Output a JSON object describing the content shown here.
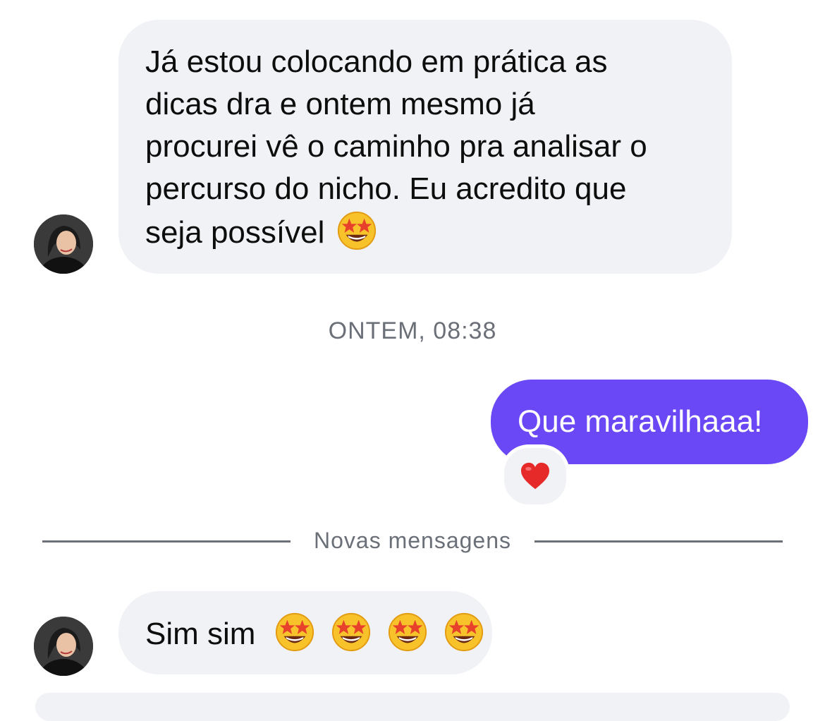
{
  "messages": {
    "incoming_1": {
      "lines": [
        "Já estou colocando em prática as",
        "dicas dra e ontem mesmo já",
        "procurei vê o caminho pra analisar o",
        "percurso do nicho. Eu acredito que",
        "seja possível"
      ],
      "emoji": "star-struck-emoji"
    },
    "timestamp": "ONTEM, 08:38",
    "outgoing_1": {
      "text": "Que maravilhaaa!",
      "reaction": "red-heart-emoji"
    },
    "new_messages_label": "Novas mensagens",
    "incoming_2": {
      "text": "Sim sim",
      "emojis": [
        "star-struck-emoji",
        "star-struck-emoji",
        "star-struck-emoji",
        "star-struck-emoji"
      ]
    }
  },
  "colors": {
    "incoming_bubble": "#f1f2f5",
    "outgoing_bubble": "#6a48f5",
    "meta_text": "#6b6f77"
  }
}
